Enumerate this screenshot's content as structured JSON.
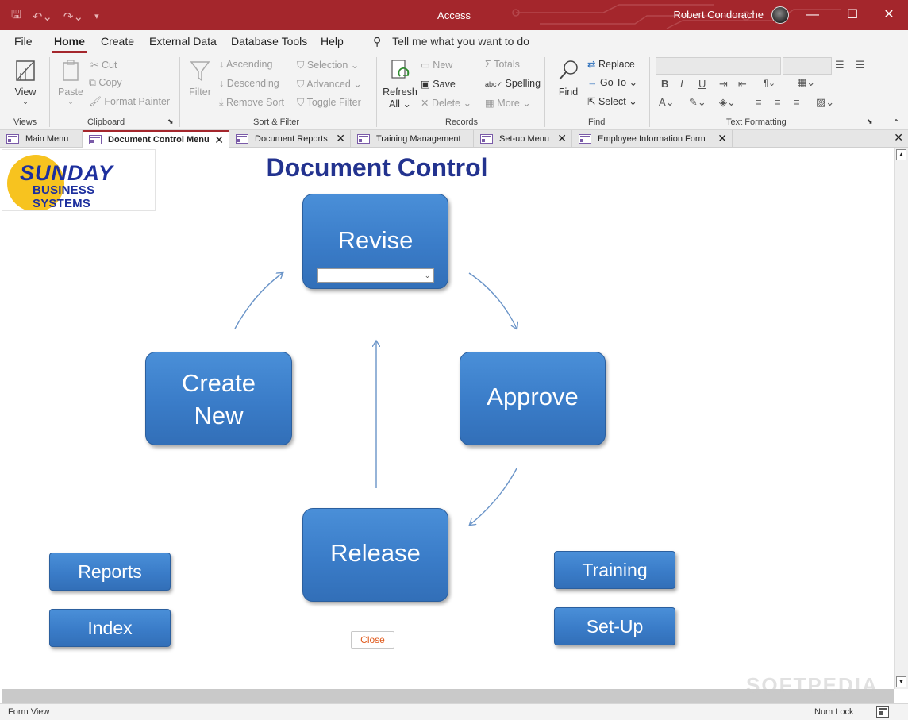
{
  "titlebar": {
    "app_title": "Access",
    "user_name": "Robert Condorache",
    "minimize": "—",
    "maximize": "☐",
    "close": "✕"
  },
  "menu": {
    "tabs": [
      "File",
      "Home",
      "Create",
      "External Data",
      "Database Tools",
      "Help"
    ],
    "active": "Home",
    "tell_me": "Tell me what you want to do"
  },
  "ribbon": {
    "views": {
      "label": "Views",
      "view": "View"
    },
    "clipboard": {
      "label": "Clipboard",
      "paste": "Paste",
      "cut": "Cut",
      "copy": "Copy",
      "format_painter": "Format Painter"
    },
    "sort_filter": {
      "label": "Sort & Filter",
      "filter": "Filter",
      "ascending": "Ascending",
      "descending": "Descending",
      "remove_sort": "Remove Sort",
      "selection": "Selection",
      "advanced": "Advanced",
      "toggle_filter": "Toggle Filter"
    },
    "records": {
      "label": "Records",
      "refresh": "Refresh",
      "refresh_all": "All",
      "new": "New",
      "save": "Save",
      "delete": "Delete",
      "totals": "Totals",
      "spelling": "Spelling",
      "more": "More"
    },
    "find": {
      "label": "Find",
      "find": "Find",
      "replace": "Replace",
      "go_to": "Go To",
      "select": "Select"
    },
    "text_formatting": {
      "label": "Text Formatting",
      "bold": "B",
      "italic": "I",
      "underline": "U"
    }
  },
  "doc_tabs": [
    {
      "label": "Main Menu",
      "active": false,
      "closable": false
    },
    {
      "label": "Document Control Menu",
      "active": true,
      "closable": true
    },
    {
      "label": "Document Reports",
      "active": false,
      "closable": true
    },
    {
      "label": "Training Management",
      "active": false,
      "closable": false
    },
    {
      "label": "Set-up Menu",
      "active": false,
      "closable": true
    },
    {
      "label": "Employee Information Form",
      "active": false,
      "closable": true
    }
  ],
  "form": {
    "logo_line1": "SUNDAY",
    "logo_line2": "BUSINESS SYSTEMS",
    "title": "Document Control",
    "revise": "Revise",
    "create_line1": "Create",
    "create_line2": "New",
    "approve": "Approve",
    "release": "Release",
    "reports": "Reports",
    "index": "Index",
    "training": "Training",
    "setup": "Set-Up",
    "close": "Close"
  },
  "status": {
    "view": "Form View",
    "num_lock": "Num Lock"
  },
  "watermark": "SOFTPEDIA",
  "colors": {
    "titlebar": "#a4262c",
    "button_blue": "#3a7cc8",
    "title_text": "#23338f",
    "logo_yellow": "#f7c31f",
    "logo_blue": "#1d2f9e",
    "close_text": "#e05a1c"
  }
}
